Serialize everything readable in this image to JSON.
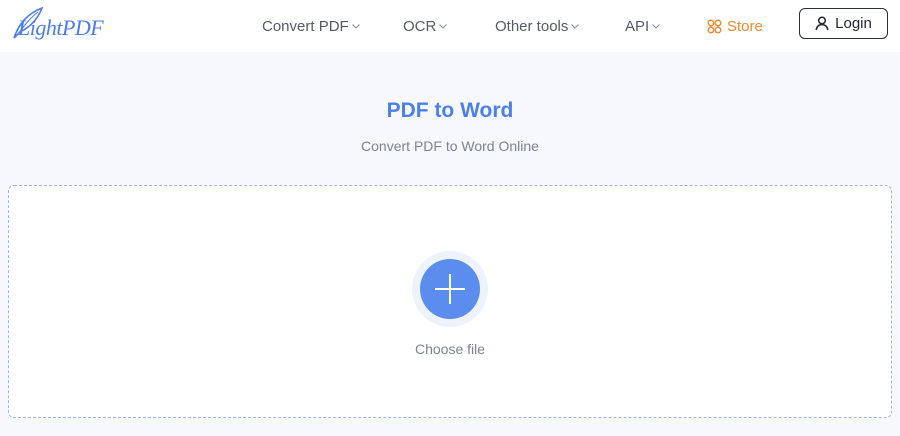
{
  "header": {
    "logo_text": "LightPDF",
    "nav": {
      "convert_pdf": "Convert PDF",
      "ocr": "OCR",
      "other_tools": "Other tools",
      "api": "API",
      "store": "Store"
    },
    "login_label": "Login"
  },
  "main": {
    "title": "PDF to Word",
    "subtitle": "Convert PDF to Word Online",
    "choose_file_label": "Choose file"
  },
  "icons": {
    "logo": "feather-logo-icon",
    "dropdown": "chevron-down-icon",
    "store": "store-icon",
    "login": "user-icon",
    "add": "plus-icon"
  },
  "colors": {
    "brand_blue": "#4a80e8",
    "button_blue": "#5b8def",
    "store_orange": "#f08a2c",
    "background": "#f7f8fc"
  }
}
